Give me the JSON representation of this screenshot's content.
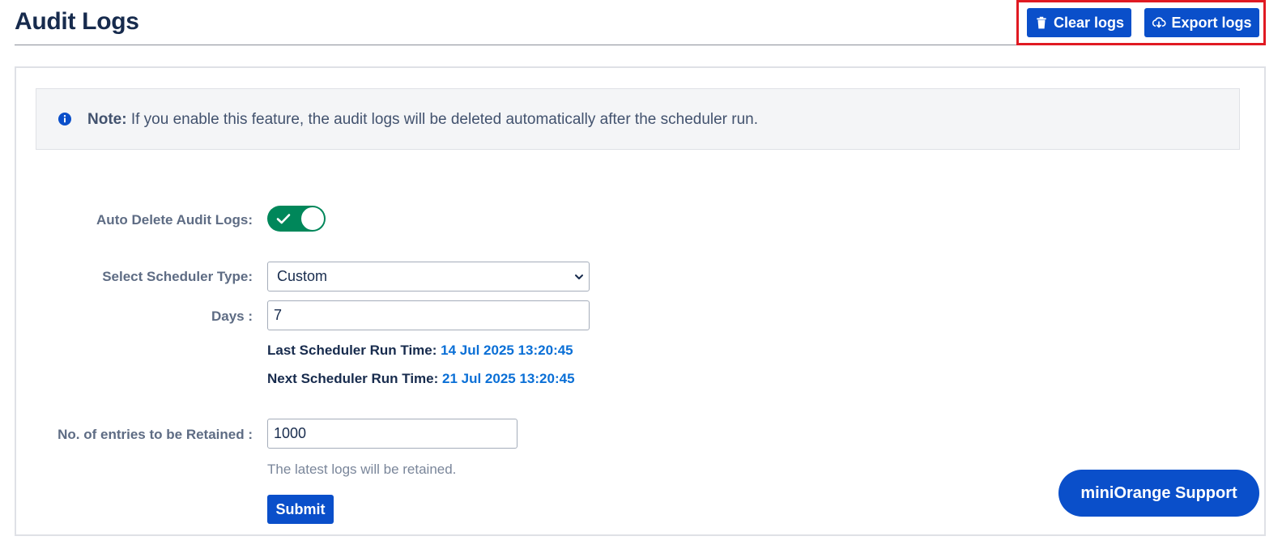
{
  "header": {
    "title": "Audit Logs",
    "clear_label": "Clear logs",
    "export_label": "Export logs"
  },
  "note": {
    "prefix": "Note:",
    "text": " If you enable this feature, the audit logs will be deleted automatically after the scheduler run."
  },
  "form": {
    "auto_delete_label": "Auto Delete Audit Logs:",
    "auto_delete_on": true,
    "scheduler_label": "Select Scheduler Type:",
    "scheduler_value": "Custom",
    "days_label": "Days :",
    "days_value": "7",
    "last_run_label": "Last Scheduler Run Time: ",
    "last_run_value": "14 Jul 2025 13:20:45",
    "next_run_label": "Next Scheduler Run Time: ",
    "next_run_value": "21 Jul 2025 13:20:45",
    "entries_label": "No. of entries to be Retained :",
    "entries_value": "1000",
    "entries_hint": "The latest logs will be retained.",
    "submit_label": "Submit"
  },
  "support": {
    "label": "miniOrange Support"
  },
  "colors": {
    "primary": "#0a4fca",
    "toggle_on": "#00875a",
    "highlight": "#e01a22",
    "timestamp": "#0a6fd6"
  }
}
